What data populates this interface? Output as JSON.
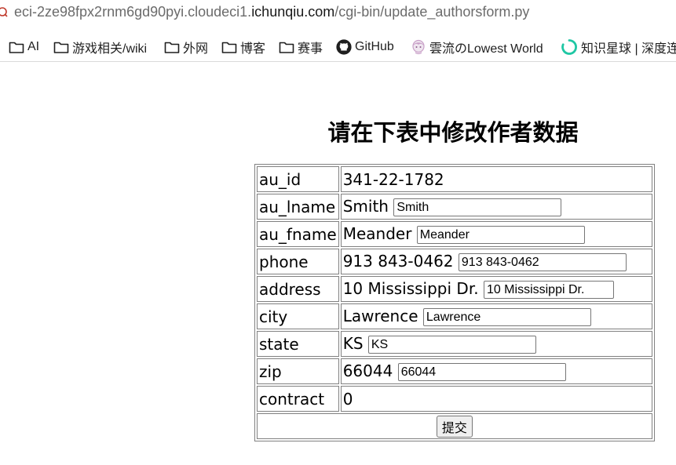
{
  "browser": {
    "url_prefix": "eci-2ze98fpx2rnm6gd90pyi.cloudeci1.",
    "url_host": "ichunqiu.com",
    "url_path": "/cgi-bin/update_authorsform.py"
  },
  "bookmarks": [
    {
      "label": "AI",
      "icon": "folder-icon"
    },
    {
      "label": "游戏相关/wiki",
      "icon": "folder-icon"
    },
    {
      "label": "外网",
      "icon": "folder-icon"
    },
    {
      "label": "博客",
      "icon": "folder-icon"
    },
    {
      "label": "赛事",
      "icon": "folder-icon"
    },
    {
      "label": "GitHub",
      "icon": "github-icon"
    },
    {
      "label": "雲流のLowest World",
      "icon": "anime-avatar-icon"
    },
    {
      "label": "知识星球 | 深度连",
      "icon": "ring-logo-icon"
    }
  ],
  "page": {
    "title": "请在下表中修改作者数据"
  },
  "form": {
    "rows": [
      {
        "label": "au_id",
        "value": "341-22-1782"
      },
      {
        "label": "au_lname",
        "value": "Smith",
        "input": "Smith"
      },
      {
        "label": "au_fname",
        "value": "Meander",
        "input": "Meander"
      },
      {
        "label": "phone",
        "value": "913 843-0462",
        "input": "913 843-0462"
      },
      {
        "label": "address",
        "value": "10 Mississippi Dr.",
        "input": "10 Mississippi Dr."
      },
      {
        "label": "city",
        "value": "Lawrence",
        "input": "Lawrence"
      },
      {
        "label": "state",
        "value": "KS",
        "input": "KS"
      },
      {
        "label": "zip",
        "value": "66044",
        "input": "66044"
      },
      {
        "label": "contract",
        "value": "0"
      }
    ],
    "submit_label": "提交"
  },
  "colors": {
    "ring_logo": "#1fc7a4",
    "anime_icon": "#c9a0c8"
  }
}
